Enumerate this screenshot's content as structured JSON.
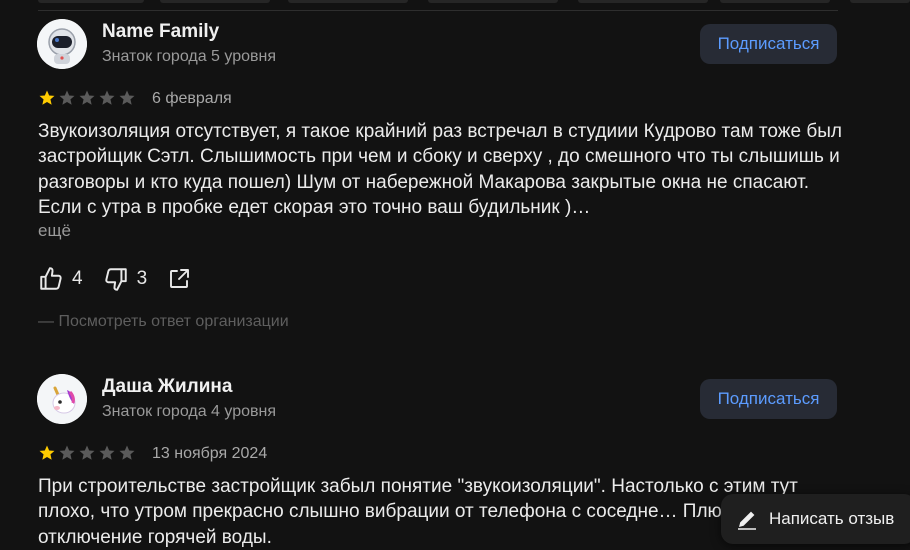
{
  "reviews": [
    {
      "author": "Name Family",
      "level": "Знаток города 5 уровня",
      "subscribe_label": "Подписаться",
      "rating": 1,
      "date": "6 февраля",
      "text": "Звукоизоляция отсутствует, я такое крайний раз встречал в студиии Кудрово там тоже был застройщик Сэтл. Слышимость при чем и сбоку и сверху , до смешного что ты слышишь и разговоры и кто куда пошел) Шум от набережной Макарова закрытые окна не спасают. Если с утра в пробке едет скорая это точно ваш будильник )…",
      "more_label": "ещё",
      "likes": "4",
      "dislikes": "3",
      "org_reply_label": "— Посмотреть ответ организации"
    },
    {
      "author": "Даша Жилина",
      "level": "Знаток города 4 уровня",
      "subscribe_label": "Подписаться",
      "rating": 1,
      "date": "13 ноября 2024",
      "text": "При строительстве застройщик забыл понятие \"звукоизоляции\". Настолько с этим тут плохо, что утром прекрасно слышно вибрации от телефона с соседне… Плюсом, частое отключение горячей воды."
    }
  ],
  "write_review_label": "Написать отзыв",
  "colors": {
    "background": "#121212",
    "accent_link": "#5c9cff",
    "star_active": "#fc0",
    "star_inactive": "#5a5a5a"
  }
}
